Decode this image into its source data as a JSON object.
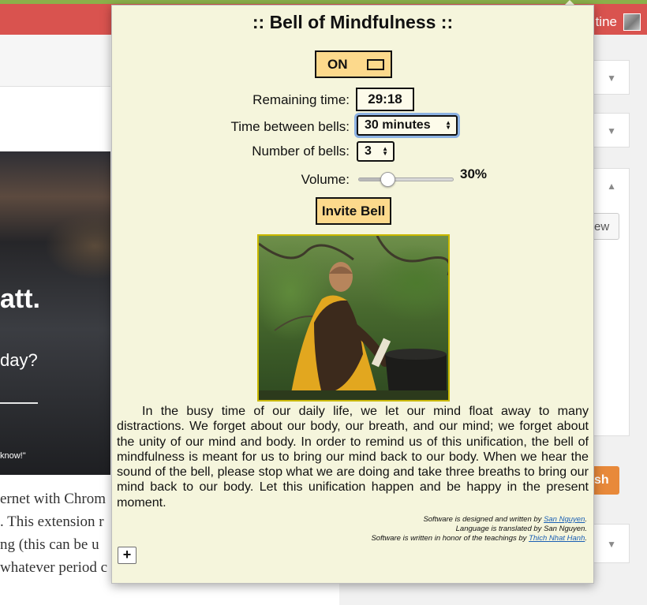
{
  "background": {
    "user_name_partial": "tine",
    "hero": {
      "title_partial": "att.",
      "subtitle_partial": "day?",
      "caption_partial": "know!\""
    },
    "article_lines": [
      "ernet with Chrom",
      ". This extension r",
      "ng (this can be u",
      "whatever period c"
    ],
    "preview_partial": "ew",
    "publish_partial": "sh"
  },
  "popup": {
    "title": ":: Bell of Mindfulness ::",
    "toggle": {
      "label": "ON"
    },
    "remaining": {
      "label": "Remaining time:",
      "value": "29:18"
    },
    "interval": {
      "label": "Time between bells:",
      "selected": "30 minutes"
    },
    "count": {
      "label": "Number of bells:",
      "selected": "3"
    },
    "volume": {
      "label": "Volume:",
      "display": "30%",
      "percent": 30
    },
    "invite_label": "Invite Bell",
    "passage": "In the busy time of our daily life, we let our mind float away to many distractions. We forget about our body, our breath, and our mind; we forget about the unity of our mind and body. In order to remind us of this unification, the bell of mindfulness is meant for us to bring our mind back to our body. When we hear the sound of the bell, please stop what we are doing and take three breaths to bring our mind back to our body. Let this unification happen and be happy in the present moment.",
    "credits": {
      "line1_prefix": "Software is designed and written by ",
      "line1_link": "San Nguyen",
      "line1_suffix": ".",
      "line2": "Language is translated by San Nguyen.",
      "line3_prefix": "Software is written in honor of the teachings by ",
      "line3_link": "Thich Nhat Hanh",
      "line3_suffix": "."
    },
    "expand_label": "+"
  },
  "colors": {
    "popup_bg": "#f5f5dc",
    "button_bg": "#fcd98c",
    "topbar_bg": "#d9534f",
    "focus_ring": "#8db2e3",
    "publish_bg": "#e8893a"
  }
}
